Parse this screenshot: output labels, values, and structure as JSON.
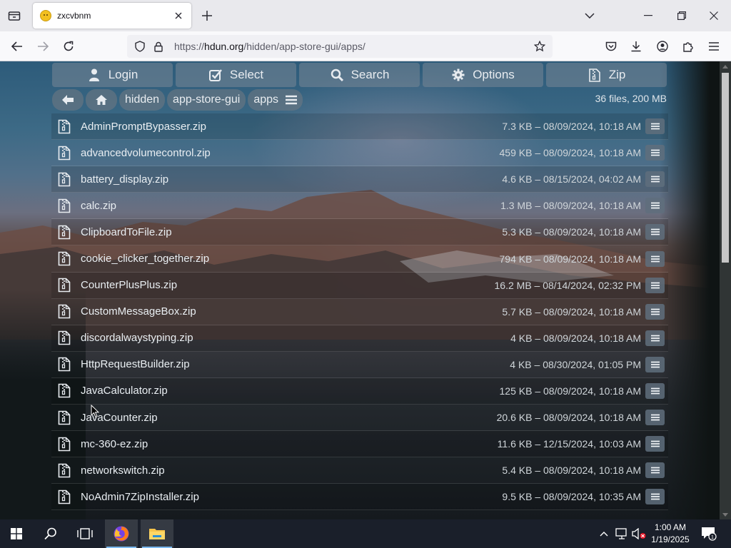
{
  "browser": {
    "tab_title": "zxcvbnm",
    "url_prefix": "https://",
    "url_host": "hdun.org",
    "url_path": "/hidden/app-store-gui/apps/"
  },
  "toolbar": {
    "login": "Login",
    "select": "Select",
    "search": "Search",
    "options": "Options",
    "zip": "Zip"
  },
  "breadcrumb": [
    "hidden",
    "app-store-gui",
    "apps"
  ],
  "summary": "36 files, 200 MB",
  "files": [
    {
      "name": "AdminPromptBypasser.zip",
      "meta": "7.3 KB – 08/09/2024, 10:18 AM"
    },
    {
      "name": "advancedvolumecontrol.zip",
      "meta": "459 KB – 08/09/2024, 10:18 AM"
    },
    {
      "name": "battery_display.zip",
      "meta": "4.6 KB – 08/15/2024, 04:02 AM"
    },
    {
      "name": "calc.zip",
      "meta": "1.3 MB – 08/09/2024, 10:18 AM"
    },
    {
      "name": "ClipboardToFile.zip",
      "meta": "5.3 KB – 08/09/2024, 10:18 AM"
    },
    {
      "name": "cookie_clicker_together.zip",
      "meta": "794 KB – 08/09/2024, 10:18 AM"
    },
    {
      "name": "CounterPlusPlus.zip",
      "meta": "16.2 MB – 08/14/2024, 02:32 PM"
    },
    {
      "name": "CustomMessageBox.zip",
      "meta": "5.7 KB – 08/09/2024, 10:18 AM"
    },
    {
      "name": "discordalwaystyping.zip",
      "meta": "4 KB – 08/09/2024, 10:18 AM"
    },
    {
      "name": "HttpRequestBuilder.zip",
      "meta": "4 KB – 08/30/2024, 01:05 PM"
    },
    {
      "name": "JavaCalculator.zip",
      "meta": "125 KB – 08/09/2024, 10:18 AM"
    },
    {
      "name": "JavaCounter.zip",
      "meta": "20.6 KB – 08/09/2024, 10:18 AM"
    },
    {
      "name": "mc-360-ez.zip",
      "meta": "11.6 KB – 12/15/2024, 10:03 AM"
    },
    {
      "name": "networkswitch.zip",
      "meta": "5.4 KB – 08/09/2024, 10:18 AM"
    },
    {
      "name": "NoAdmin7ZipInstaller.zip",
      "meta": "9.5 KB – 08/09/2024, 10:35 AM"
    }
  ],
  "taskbar": {
    "time": "1:00 AM",
    "date": "1/19/2025",
    "notification_count": "1"
  },
  "icons": {
    "tab_favicon": "smiley-favicon-icon",
    "file": "zip-file-icon",
    "row_menu": "hamburger-menu-icon"
  }
}
